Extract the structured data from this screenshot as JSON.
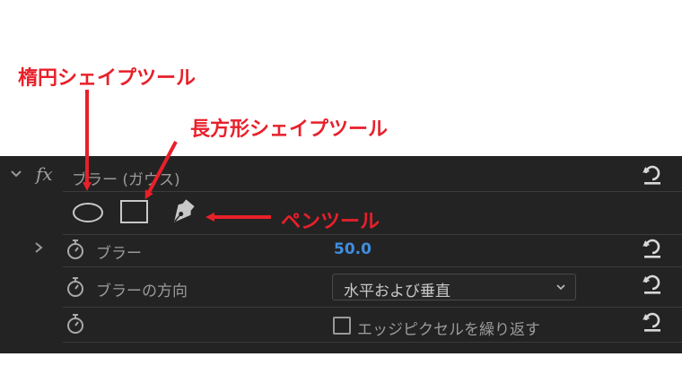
{
  "annotations": {
    "ellipse_tool": "楕円シェイプツール",
    "rectangle_tool": "長方形シェイプツール",
    "pen_tool": "ペンツール"
  },
  "effect": {
    "fx_label": "fx",
    "name": "ブラー (ガウス)"
  },
  "properties": {
    "blurriness_label": "ブラー",
    "blurriness_value": "50.0",
    "direction_label": "ブラーの方向",
    "direction_value": "水平および垂直",
    "repeat_edge_label": "エッジピクセルを繰り返す",
    "repeat_edge_checked": false
  },
  "colors": {
    "panel_bg": "#232323",
    "value_blue": "#3f8ee0",
    "annotation_red": "#e8202a"
  }
}
